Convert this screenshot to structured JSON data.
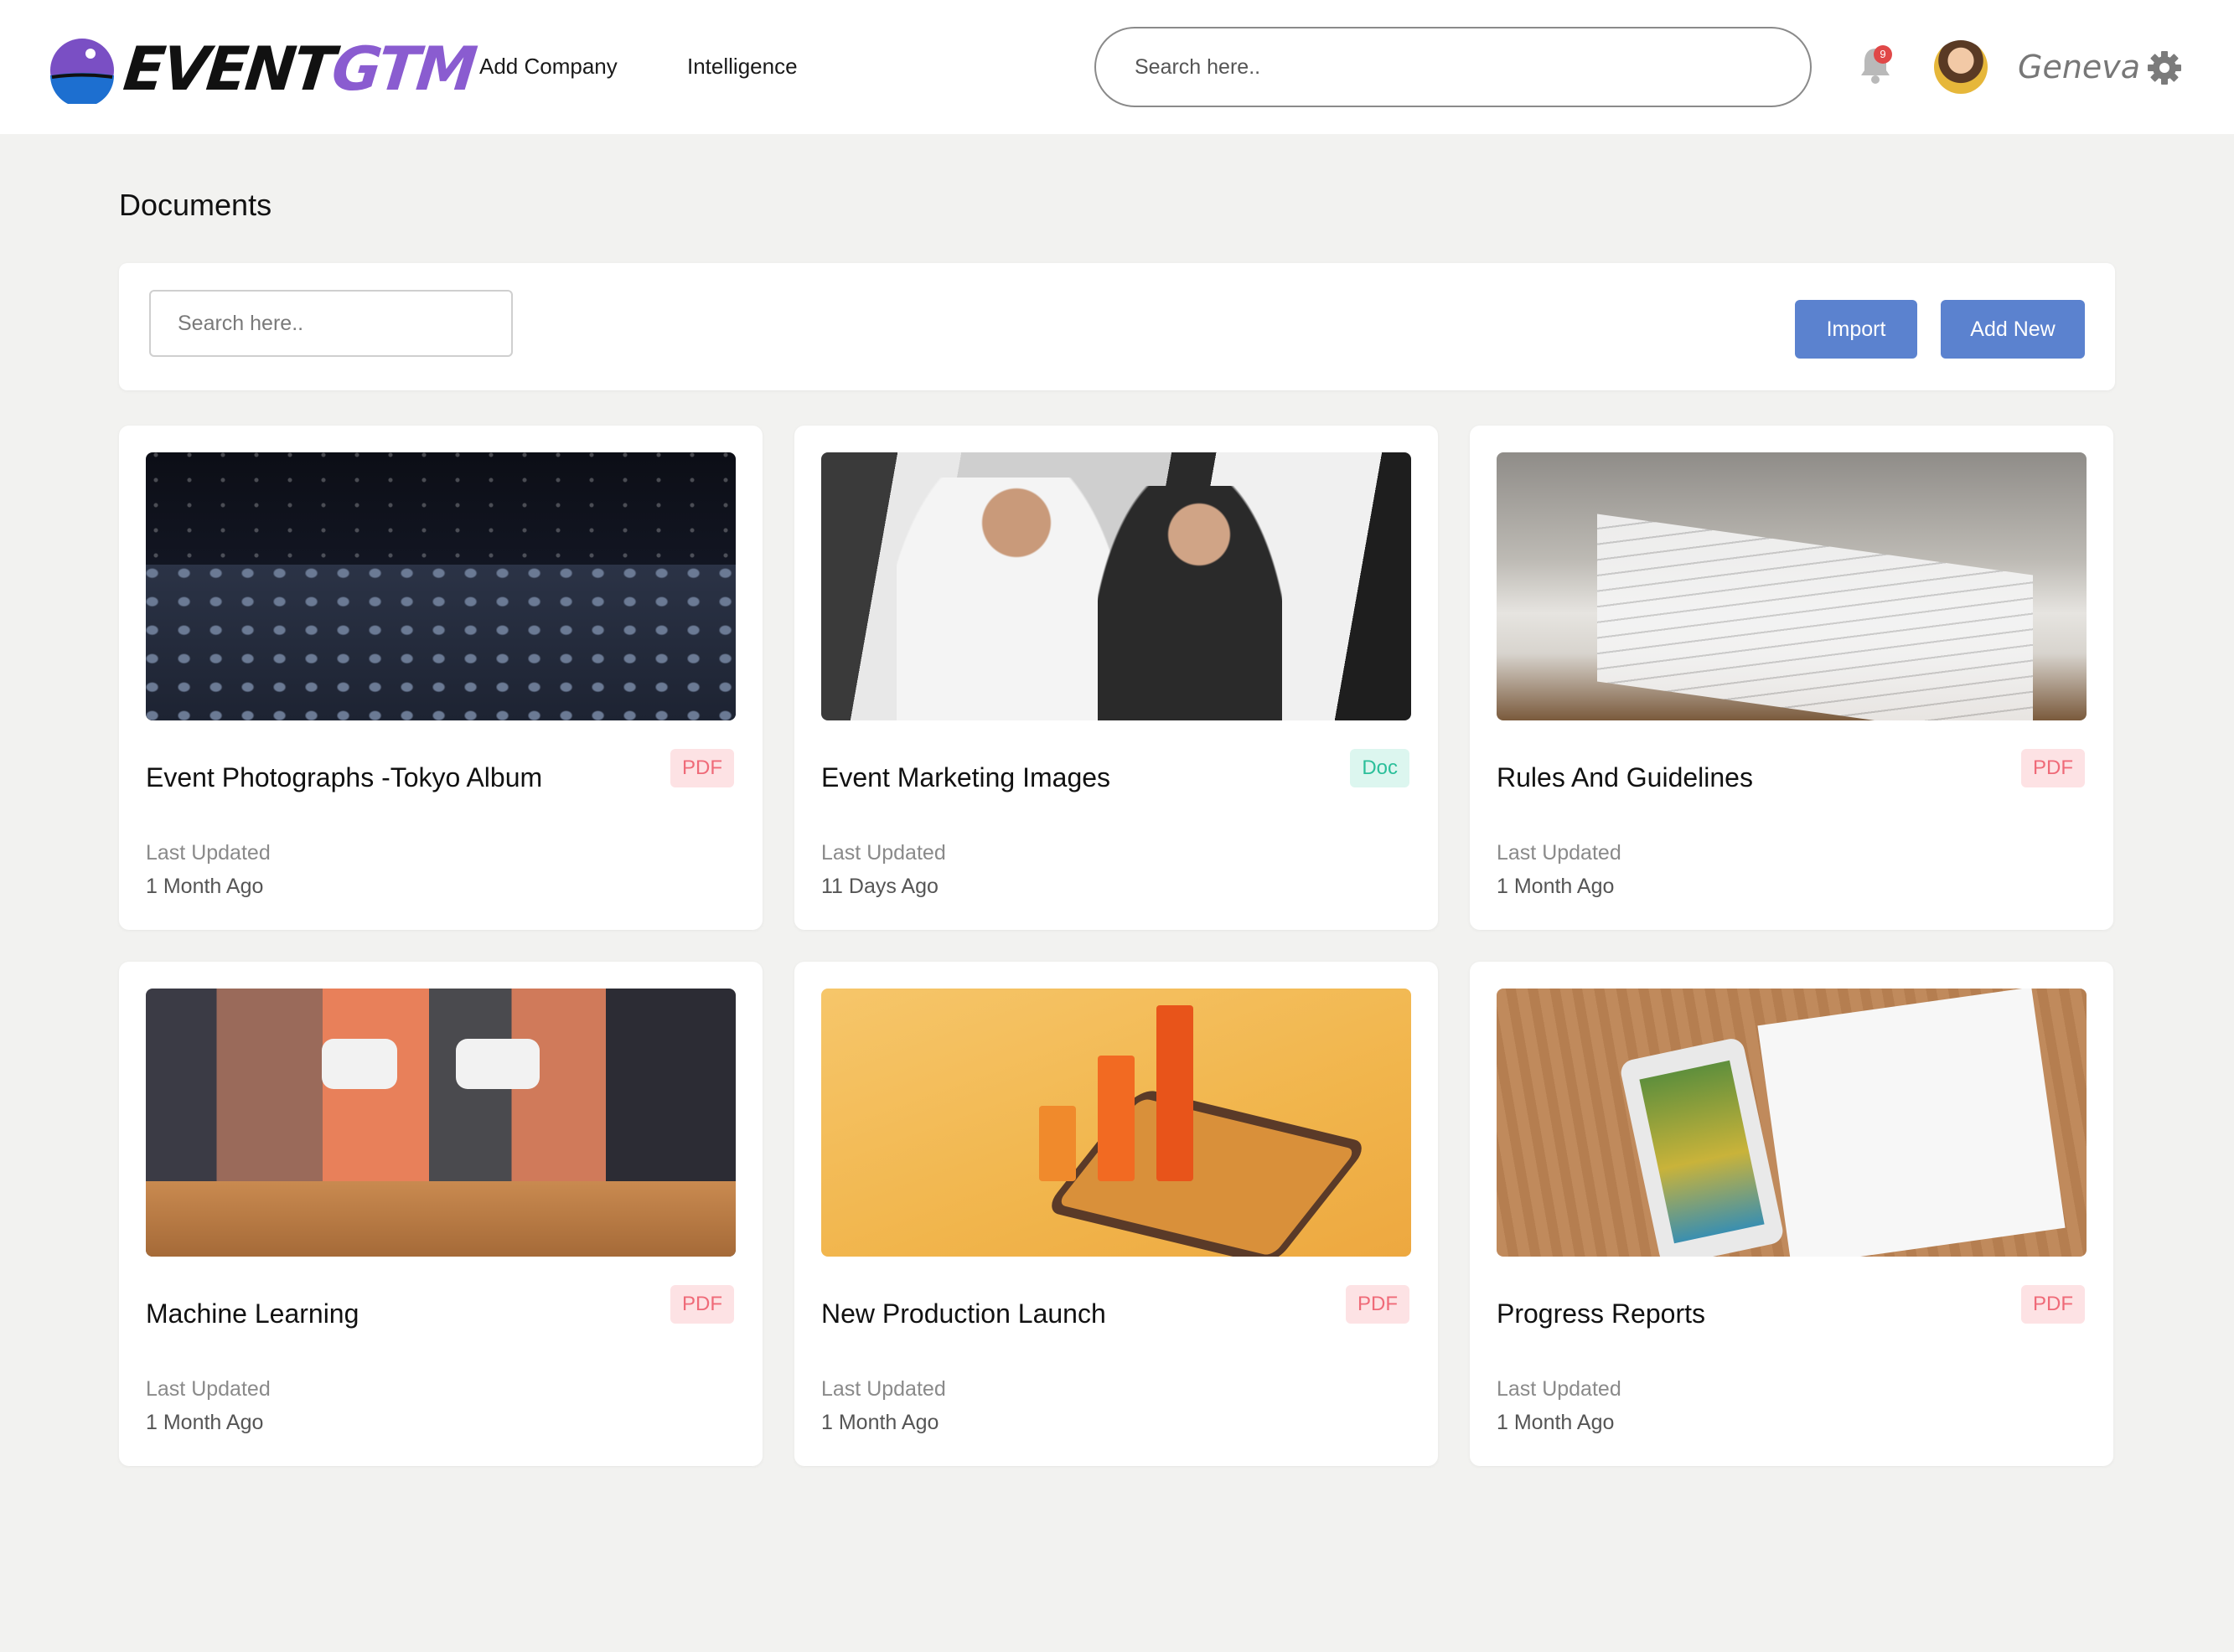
{
  "header": {
    "logo": {
      "part1": "EVENT",
      "part2": "GTM"
    },
    "nav": [
      {
        "label": "Add Company"
      },
      {
        "label": "Intelligence"
      }
    ],
    "search_placeholder": "Search here..",
    "notification_count": "9",
    "user_name": "Geneva",
    "colors": {
      "accent": "#5b82cf",
      "logo_purple": "#8a5cd0",
      "badge_red": "#e04848"
    }
  },
  "page": {
    "title": "Documents",
    "search_placeholder": "Search here..",
    "import_label": "Import",
    "add_new_label": "Add New"
  },
  "documents": [
    {
      "title": "Event Photographs -Tokyo Album",
      "type": "PDF",
      "updated_label": "Last Updated",
      "updated_value": "1 Month Ago"
    },
    {
      "title": "Event Marketing Images",
      "type": "Doc",
      "updated_label": "Last Updated",
      "updated_value": "11 Days Ago"
    },
    {
      "title": "Rules And Guidelines",
      "type": "PDF",
      "updated_label": "Last Updated",
      "updated_value": "1 Month Ago"
    },
    {
      "title": "Machine Learning",
      "type": "PDF",
      "updated_label": "Last Updated",
      "updated_value": "1 Month Ago"
    },
    {
      "title": "New Production Launch",
      "type": "PDF",
      "updated_label": "Last Updated",
      "updated_value": "1 Month Ago"
    },
    {
      "title": "Progress Reports",
      "type": "PDF",
      "updated_label": "Last Updated",
      "updated_value": "1 Month Ago"
    }
  ]
}
